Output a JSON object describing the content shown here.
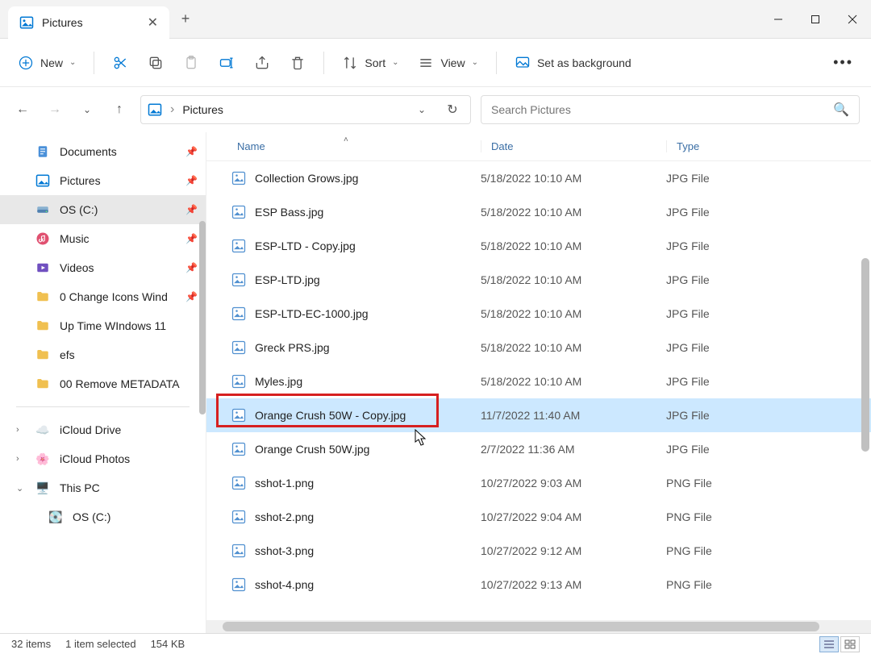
{
  "tab": {
    "title": "Pictures"
  },
  "toolbar": {
    "new": "New",
    "sort": "Sort",
    "view": "View",
    "background": "Set as background"
  },
  "address": {
    "location": "Pictures"
  },
  "search": {
    "placeholder": "Search Pictures"
  },
  "columns": {
    "name": "Name",
    "date": "Date",
    "type": "Type"
  },
  "sidebar": {
    "items": [
      {
        "label": "Documents",
        "icon": "doc",
        "pinned": true
      },
      {
        "label": "Pictures",
        "icon": "pic",
        "pinned": true
      },
      {
        "label": "OS (C:)",
        "icon": "disk",
        "pinned": true,
        "selected": true
      },
      {
        "label": "Music",
        "icon": "music",
        "pinned": true
      },
      {
        "label": "Videos",
        "icon": "video",
        "pinned": true
      },
      {
        "label": "0 Change Icons Wind",
        "icon": "folder",
        "pinned": true
      },
      {
        "label": "Up Time WIndows 11",
        "icon": "folder"
      },
      {
        "label": "efs",
        "icon": "folder"
      },
      {
        "label": "00 Remove METADATA",
        "icon": "folder"
      }
    ],
    "cloud1": "iCloud Drive",
    "cloud2": "iCloud Photos",
    "thispc": "This PC",
    "osdrive": "OS (C:)"
  },
  "files": [
    {
      "name": "Collection Grows.jpg",
      "date": "5/18/2022 10:10 AM",
      "type": "JPG File"
    },
    {
      "name": "ESP Bass.jpg",
      "date": "5/18/2022 10:10 AM",
      "type": "JPG File"
    },
    {
      "name": "ESP-LTD - Copy.jpg",
      "date": "5/18/2022 10:10 AM",
      "type": "JPG File"
    },
    {
      "name": "ESP-LTD.jpg",
      "date": "5/18/2022 10:10 AM",
      "type": "JPG File"
    },
    {
      "name": "ESP-LTD-EC-1000.jpg",
      "date": "5/18/2022 10:10 AM",
      "type": "JPG File"
    },
    {
      "name": "Greck PRS.jpg",
      "date": "5/18/2022 10:10 AM",
      "type": "JPG File"
    },
    {
      "name": "Myles.jpg",
      "date": "5/18/2022 10:10 AM",
      "type": "JPG File"
    },
    {
      "name": "Orange Crush 50W - Copy.jpg",
      "date": "11/7/2022 11:40 AM",
      "type": "JPG File",
      "selected": true
    },
    {
      "name": "Orange Crush 50W.jpg",
      "date": "2/7/2022 11:36 AM",
      "type": "JPG File"
    },
    {
      "name": "sshot-1.png",
      "date": "10/27/2022 9:03 AM",
      "type": "PNG File"
    },
    {
      "name": "sshot-2.png",
      "date": "10/27/2022 9:04 AM",
      "type": "PNG File"
    },
    {
      "name": "sshot-3.png",
      "date": "10/27/2022 9:12 AM",
      "type": "PNG File"
    },
    {
      "name": "sshot-4.png",
      "date": "10/27/2022 9:13 AM",
      "type": "PNG File"
    }
  ],
  "status": {
    "count": "32 items",
    "selected": "1 item selected",
    "size": "154 KB"
  }
}
